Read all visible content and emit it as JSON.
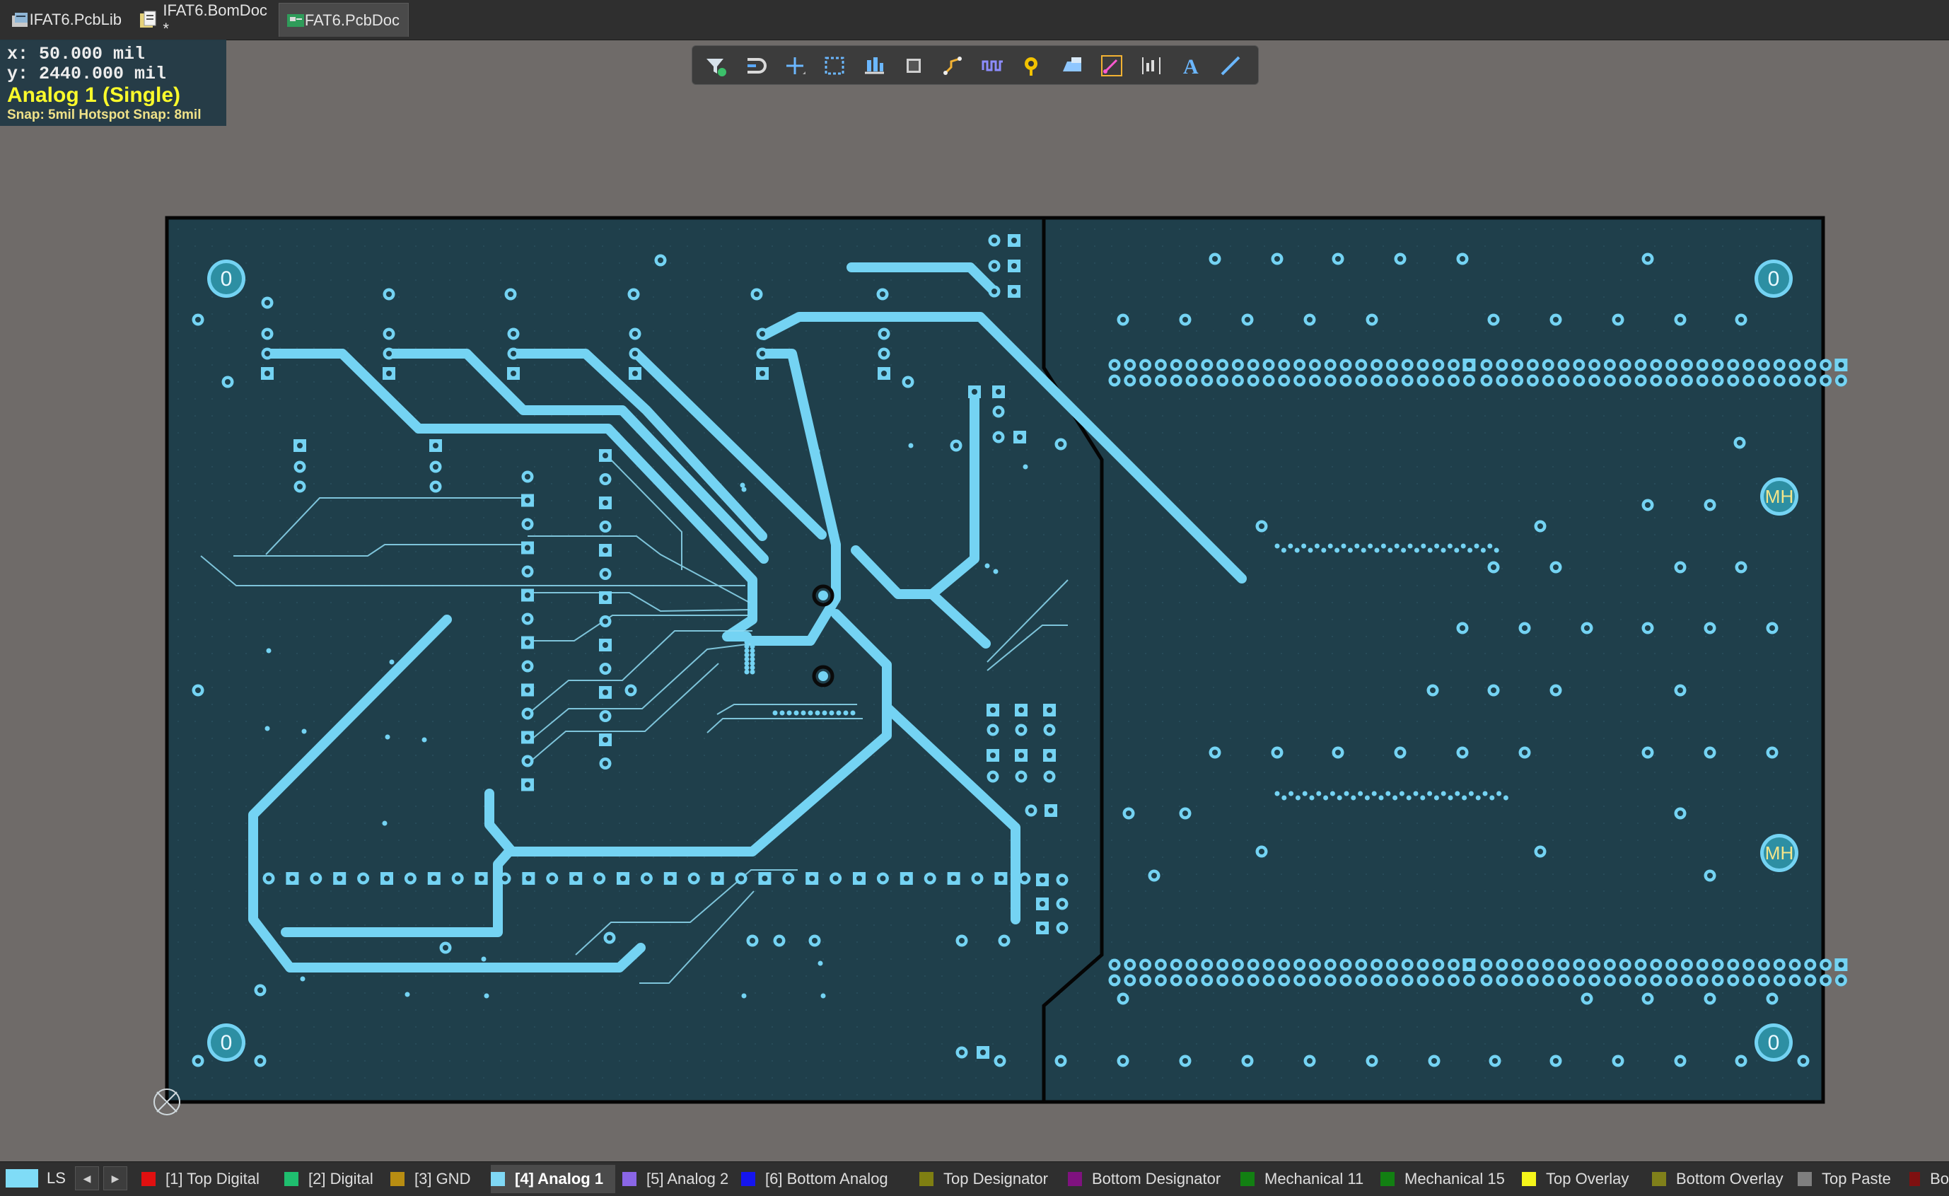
{
  "tabs": [
    {
      "label": "IFAT6.PcbLib",
      "icon": "pcb-library-icon",
      "active": false
    },
    {
      "label": "IFAT6.BomDoc *",
      "icon": "bom-document-icon",
      "active": false
    },
    {
      "label": "IFAT6.PcbDoc",
      "icon": "pcb-document-icon",
      "active": true
    }
  ],
  "hud": {
    "x_line": "x:    50.000   mil",
    "y_line": "y:  2440.000 mil",
    "layer": "Analog 1 (Single)",
    "snap": "Snap: 5mil Hotspot Snap: 8mil"
  },
  "toolbar": [
    {
      "icon": "filter-icon"
    },
    {
      "icon": "interactive-routing-magnet-icon"
    },
    {
      "icon": "add-crosshair-icon"
    },
    {
      "icon": "select-rectangle-icon"
    },
    {
      "icon": "align-components-icon"
    },
    {
      "icon": "place-component-icon"
    },
    {
      "icon": "route-track-icon"
    },
    {
      "icon": "length-tuning-icon"
    },
    {
      "icon": "place-via-icon"
    },
    {
      "icon": "place-fill-icon"
    },
    {
      "icon": "interactive-diff-pair-icon"
    },
    {
      "icon": "place-dimension-icon"
    },
    {
      "icon": "place-string-icon"
    },
    {
      "icon": "place-line-icon"
    }
  ],
  "board": {
    "mounting_hole_label": "0",
    "mh_label": "MH",
    "track_color": "#74d3f3",
    "board_fill": "#1f3f4b"
  },
  "layer_bar": {
    "ls_label": "LS",
    "prev": "◀",
    "next": "▶",
    "layers": [
      {
        "label": "[1] Top Digital",
        "color": "#e01010"
      },
      {
        "label": "[2] Digital",
        "color": "#1fbf6f"
      },
      {
        "label": "[3] GND",
        "color": "#b88d12"
      },
      {
        "label": "[4] Analog 1",
        "color": "#7fd8f5",
        "active": true
      },
      {
        "label": "[5] Analog 2",
        "color": "#8a66e6"
      },
      {
        "label": "[6] Bottom Analog",
        "color": "#1515ee"
      },
      {
        "label": "Top Designator",
        "color": "#7f7f12"
      },
      {
        "label": "Bottom Designator",
        "color": "#7f127f"
      },
      {
        "label": "Mechanical 11",
        "color": "#128012"
      },
      {
        "label": "Mechanical 15",
        "color": "#128012"
      },
      {
        "label": "Top Overlay",
        "color": "#f5f51a"
      },
      {
        "label": "Bottom Overlay",
        "color": "#80801a"
      },
      {
        "label": "Top Paste",
        "color": "#7f7f7f"
      },
      {
        "label": "Bo",
        "color": "#7f1010"
      }
    ]
  }
}
